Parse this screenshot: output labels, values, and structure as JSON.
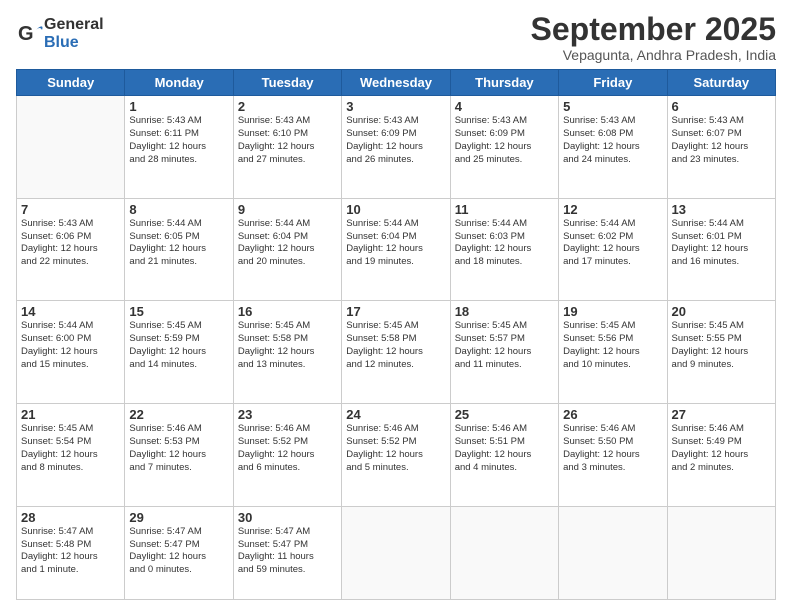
{
  "logo": {
    "general": "General",
    "blue": "Blue"
  },
  "header": {
    "month_year": "September 2025",
    "location": "Vepagunta, Andhra Pradesh, India"
  },
  "days_of_week": [
    "Sunday",
    "Monday",
    "Tuesday",
    "Wednesday",
    "Thursday",
    "Friday",
    "Saturday"
  ],
  "weeks": [
    [
      {
        "day": "",
        "info": ""
      },
      {
        "day": "1",
        "info": "Sunrise: 5:43 AM\nSunset: 6:11 PM\nDaylight: 12 hours\nand 28 minutes."
      },
      {
        "day": "2",
        "info": "Sunrise: 5:43 AM\nSunset: 6:10 PM\nDaylight: 12 hours\nand 27 minutes."
      },
      {
        "day": "3",
        "info": "Sunrise: 5:43 AM\nSunset: 6:09 PM\nDaylight: 12 hours\nand 26 minutes."
      },
      {
        "day": "4",
        "info": "Sunrise: 5:43 AM\nSunset: 6:09 PM\nDaylight: 12 hours\nand 25 minutes."
      },
      {
        "day": "5",
        "info": "Sunrise: 5:43 AM\nSunset: 6:08 PM\nDaylight: 12 hours\nand 24 minutes."
      },
      {
        "day": "6",
        "info": "Sunrise: 5:43 AM\nSunset: 6:07 PM\nDaylight: 12 hours\nand 23 minutes."
      }
    ],
    [
      {
        "day": "7",
        "info": "Sunrise: 5:43 AM\nSunset: 6:06 PM\nDaylight: 12 hours\nand 22 minutes."
      },
      {
        "day": "8",
        "info": "Sunrise: 5:44 AM\nSunset: 6:05 PM\nDaylight: 12 hours\nand 21 minutes."
      },
      {
        "day": "9",
        "info": "Sunrise: 5:44 AM\nSunset: 6:04 PM\nDaylight: 12 hours\nand 20 minutes."
      },
      {
        "day": "10",
        "info": "Sunrise: 5:44 AM\nSunset: 6:04 PM\nDaylight: 12 hours\nand 19 minutes."
      },
      {
        "day": "11",
        "info": "Sunrise: 5:44 AM\nSunset: 6:03 PM\nDaylight: 12 hours\nand 18 minutes."
      },
      {
        "day": "12",
        "info": "Sunrise: 5:44 AM\nSunset: 6:02 PM\nDaylight: 12 hours\nand 17 minutes."
      },
      {
        "day": "13",
        "info": "Sunrise: 5:44 AM\nSunset: 6:01 PM\nDaylight: 12 hours\nand 16 minutes."
      }
    ],
    [
      {
        "day": "14",
        "info": "Sunrise: 5:44 AM\nSunset: 6:00 PM\nDaylight: 12 hours\nand 15 minutes."
      },
      {
        "day": "15",
        "info": "Sunrise: 5:45 AM\nSunset: 5:59 PM\nDaylight: 12 hours\nand 14 minutes."
      },
      {
        "day": "16",
        "info": "Sunrise: 5:45 AM\nSunset: 5:58 PM\nDaylight: 12 hours\nand 13 minutes."
      },
      {
        "day": "17",
        "info": "Sunrise: 5:45 AM\nSunset: 5:58 PM\nDaylight: 12 hours\nand 12 minutes."
      },
      {
        "day": "18",
        "info": "Sunrise: 5:45 AM\nSunset: 5:57 PM\nDaylight: 12 hours\nand 11 minutes."
      },
      {
        "day": "19",
        "info": "Sunrise: 5:45 AM\nSunset: 5:56 PM\nDaylight: 12 hours\nand 10 minutes."
      },
      {
        "day": "20",
        "info": "Sunrise: 5:45 AM\nSunset: 5:55 PM\nDaylight: 12 hours\nand 9 minutes."
      }
    ],
    [
      {
        "day": "21",
        "info": "Sunrise: 5:45 AM\nSunset: 5:54 PM\nDaylight: 12 hours\nand 8 minutes."
      },
      {
        "day": "22",
        "info": "Sunrise: 5:46 AM\nSunset: 5:53 PM\nDaylight: 12 hours\nand 7 minutes."
      },
      {
        "day": "23",
        "info": "Sunrise: 5:46 AM\nSunset: 5:52 PM\nDaylight: 12 hours\nand 6 minutes."
      },
      {
        "day": "24",
        "info": "Sunrise: 5:46 AM\nSunset: 5:52 PM\nDaylight: 12 hours\nand 5 minutes."
      },
      {
        "day": "25",
        "info": "Sunrise: 5:46 AM\nSunset: 5:51 PM\nDaylight: 12 hours\nand 4 minutes."
      },
      {
        "day": "26",
        "info": "Sunrise: 5:46 AM\nSunset: 5:50 PM\nDaylight: 12 hours\nand 3 minutes."
      },
      {
        "day": "27",
        "info": "Sunrise: 5:46 AM\nSunset: 5:49 PM\nDaylight: 12 hours\nand 2 minutes."
      }
    ],
    [
      {
        "day": "28",
        "info": "Sunrise: 5:47 AM\nSunset: 5:48 PM\nDaylight: 12 hours\nand 1 minute."
      },
      {
        "day": "29",
        "info": "Sunrise: 5:47 AM\nSunset: 5:47 PM\nDaylight: 12 hours\nand 0 minutes."
      },
      {
        "day": "30",
        "info": "Sunrise: 5:47 AM\nSunset: 5:47 PM\nDaylight: 11 hours\nand 59 minutes."
      },
      {
        "day": "",
        "info": ""
      },
      {
        "day": "",
        "info": ""
      },
      {
        "day": "",
        "info": ""
      },
      {
        "day": "",
        "info": ""
      }
    ]
  ]
}
